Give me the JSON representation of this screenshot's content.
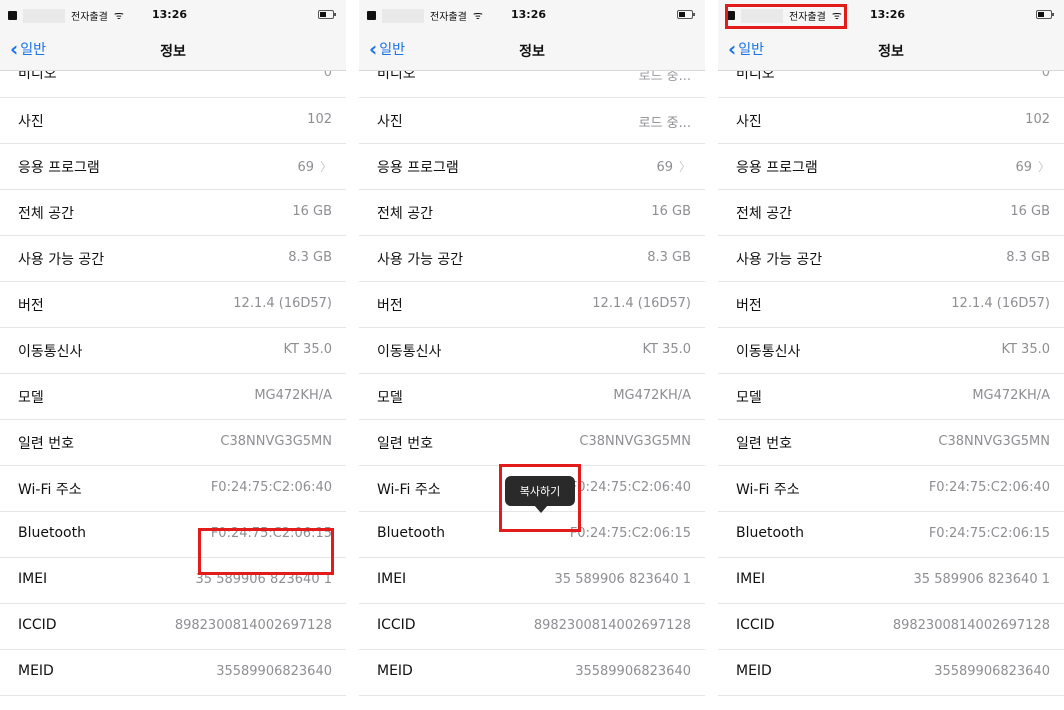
{
  "panels": [
    {
      "status": {
        "carrier": "전자출결",
        "time": "13:26"
      },
      "nav": {
        "back_label": "일반",
        "title": "정보"
      },
      "partial_row": {
        "label": "비디오",
        "value": "0"
      },
      "rows": [
        {
          "label": "사진",
          "value": "102"
        },
        {
          "label": "응용 프로그램",
          "value": "69",
          "chevron": "〉"
        },
        {
          "label": "전체 공간",
          "value": "16 GB"
        },
        {
          "label": "사용 가능 공간",
          "value": "8.3 GB"
        },
        {
          "label": "버전",
          "value": "12.1.4 (16D57)"
        },
        {
          "label": "이동통신사",
          "value": "KT 35.0"
        },
        {
          "label": "모델",
          "value": "MG472KH/A"
        },
        {
          "label": "일련 번호",
          "value": "C38NNVG3G5MN"
        },
        {
          "label": "Wi-Fi 주소",
          "value": "F0:24:75:C2:06:40"
        },
        {
          "label": "Bluetooth",
          "value": "F0:24:75:C2:06:15"
        },
        {
          "label": "IMEI",
          "value": "35 589906 823640 1"
        },
        {
          "label": "ICCID",
          "value": "8982300814002697128"
        },
        {
          "label": "MEID",
          "value": "35589906823640"
        }
      ]
    },
    {
      "status": {
        "carrier": "전자출결",
        "time": "13:26"
      },
      "nav": {
        "back_label": "일반",
        "title": "정보"
      },
      "partial_row": {
        "label": "비디오",
        "value": "로드 중..."
      },
      "rows": [
        {
          "label": "사진",
          "value": "로드 중..."
        },
        {
          "label": "응용 프로그램",
          "value": "69",
          "chevron": "〉"
        },
        {
          "label": "전체 공간",
          "value": "16 GB"
        },
        {
          "label": "사용 가능 공간",
          "value": "8.3 GB"
        },
        {
          "label": "버전",
          "value": "12.1.4 (16D57)"
        },
        {
          "label": "이동통신사",
          "value": "KT 35.0"
        },
        {
          "label": "모델",
          "value": "MG472KH/A"
        },
        {
          "label": "일련 번호",
          "value": "C38NNVG3G5MN"
        },
        {
          "label": "Wi-Fi 주소",
          "value": "F0:24:75:C2:06:40"
        },
        {
          "label": "Bluetooth",
          "value": "F0:24:75:C2:06:15"
        },
        {
          "label": "IMEI",
          "value": "35 589906 823640 1"
        },
        {
          "label": "ICCID",
          "value": "8982300814002697128"
        },
        {
          "label": "MEID",
          "value": "35589906823640"
        }
      ],
      "tooltip": "복사하기"
    },
    {
      "status": {
        "carrier": "전자출결",
        "time": "13:26"
      },
      "nav": {
        "back_label": "일반",
        "title": "정보"
      },
      "partial_row": {
        "label": "비디오",
        "value": "0"
      },
      "rows": [
        {
          "label": "사진",
          "value": "102"
        },
        {
          "label": "응용 프로그램",
          "value": "69",
          "chevron": "〉"
        },
        {
          "label": "전체 공간",
          "value": "16 GB"
        },
        {
          "label": "사용 가능 공간",
          "value": "8.3 GB"
        },
        {
          "label": "버전",
          "value": "12.1.4 (16D57)"
        },
        {
          "label": "이동통신사",
          "value": "KT 35.0"
        },
        {
          "label": "모델",
          "value": "MG472KH/A"
        },
        {
          "label": "일련 번호",
          "value": "C38NNVG3G5MN"
        },
        {
          "label": "Wi-Fi 주소",
          "value": "F0:24:75:C2:06:40"
        },
        {
          "label": "Bluetooth",
          "value": "F0:24:75:C2:06:15"
        },
        {
          "label": "IMEI",
          "value": "35 589906 823640 1"
        },
        {
          "label": "ICCID",
          "value": "8982300814002697128"
        },
        {
          "label": "MEID",
          "value": "35589906823640"
        }
      ]
    }
  ],
  "colors": {
    "highlight": "#e41b1b",
    "link": "#1a73e8",
    "value_text": "#8e8e93"
  }
}
